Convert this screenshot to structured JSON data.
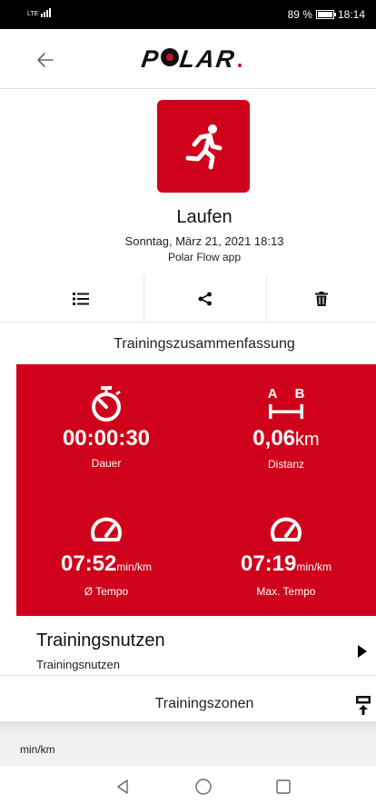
{
  "status_bar": {
    "network": "LTE",
    "battery_text": "89 %",
    "battery_level": 0.89,
    "time": "18:14"
  },
  "app_bar": {
    "back_icon": "arrow-left-icon",
    "brand": "POLAR"
  },
  "activity": {
    "sport_icon": "running-icon",
    "sport": "Laufen",
    "date": "Sonntag, März 21, 2021 18:13",
    "source": "Polar Flow app"
  },
  "actions": [
    {
      "icon": "list-icon"
    },
    {
      "icon": "share-icon"
    },
    {
      "icon": "trash-icon"
    }
  ],
  "summary": {
    "title": "Trainingszusammenfassung",
    "duration": {
      "icon": "stopwatch-icon",
      "value": "00:00:30",
      "label": "Dauer"
    },
    "distance": {
      "icon": "distance-a-b-icon",
      "value": "0,06",
      "unit": "km",
      "label": "Distanz",
      "icon_a": "A",
      "icon_b": "B"
    },
    "avg_pace": {
      "icon": "speedometer-icon",
      "value": "07:52",
      "unit": "min/km",
      "label": "Ø Tempo"
    },
    "max_pace": {
      "icon": "speedometer-icon",
      "value": "07:19",
      "unit": "min/km",
      "label": "Max. Tempo"
    }
  },
  "training_benefit": {
    "title": "Trainingsnutzen",
    "subtitle": "Trainingsnutzen"
  },
  "training_zones": {
    "title": "Trainingszonen",
    "button_icon": "upload-icon"
  },
  "chart_strip": {
    "unit": "min/km"
  },
  "colors": {
    "brand_red": "#d0021b",
    "text": "#111111"
  }
}
